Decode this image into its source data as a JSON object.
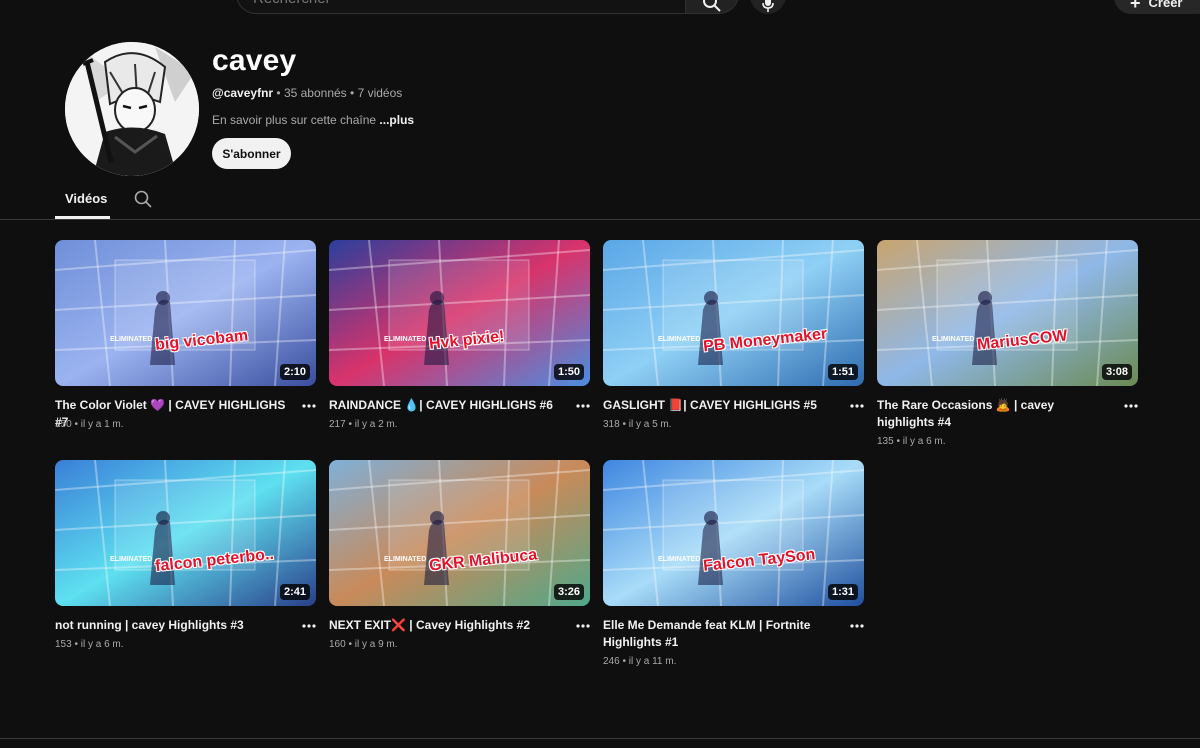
{
  "topbar": {
    "search_placeholder": "Rechercher",
    "create_label": "Créer"
  },
  "channel": {
    "name": "cavey",
    "handle": "@caveyfnr",
    "subscribers": "35 abonnés",
    "video_count": "7 vidéos",
    "separator": " • ",
    "about_text": "En savoir plus sur cette chaîne ",
    "about_more": "...plus",
    "subscribe_label": "S'abonner"
  },
  "tabs": {
    "videos_label": "Vidéos"
  },
  "videos": [
    {
      "title": "The Color Violet 💜 | CAVEY HIGHLIGHS #7",
      "views": "150",
      "age": "il y a 1 m.",
      "duration": "2:10",
      "overlay": "big vicobam",
      "palette": [
        "#6f8fd8",
        "#9bb3f0",
        "#3a4e9e"
      ]
    },
    {
      "title": "RAINDANCE 💧| CAVEY HIGHLIGHS #6",
      "views": "217",
      "age": "il y a 2 m.",
      "duration": "1:50",
      "overlay": "Hvk pixie!",
      "palette": [
        "#2b3f9c",
        "#d8336b",
        "#4a8ee0"
      ]
    },
    {
      "title": "GASLIGHT 📕| CAVEY HIGHLIGHS #5",
      "views": "318",
      "age": "il y a 5 m.",
      "duration": "1:51",
      "overlay": "PB Moneymaker",
      "palette": [
        "#5aa6e6",
        "#8fd0f5",
        "#2e6bb0"
      ]
    },
    {
      "title": "The Rare Occasions 🙇 | cavey highlights #4",
      "views": "135",
      "age": "il y a 6 m.",
      "duration": "3:08",
      "overlay": "MariusCOW",
      "palette": [
        "#c9a46f",
        "#8fb8e8",
        "#6b8a52"
      ]
    },
    {
      "title": "not running | cavey Highlights #3",
      "views": "153",
      "age": "il y a 6 m.",
      "duration": "2:41",
      "overlay": "falcon peterbo..",
      "palette": [
        "#3a7fd8",
        "#5ee0f0",
        "#2a3f8a"
      ]
    },
    {
      "title": "NEXT EXIT❌ | Cavey Highlights #2",
      "views": "160",
      "age": "il y a 9 m.",
      "duration": "3:26",
      "overlay": "GKR Malibuca",
      "palette": [
        "#7fb0d8",
        "#c98a5a",
        "#4fa88a"
      ]
    },
    {
      "title": "Elle Me Demande feat KLM | Fortnite Highlights #1",
      "views": "246",
      "age": "il y a 11 m.",
      "duration": "1:31",
      "overlay": "Falcon TaySon",
      "palette": [
        "#3f86e0",
        "#a8dcf8",
        "#1f4f9e"
      ]
    }
  ],
  "colors": {
    "background": "#0f0f0f",
    "text_primary": "#f1f1f1",
    "text_secondary": "#aaaaaa",
    "overlay_red": "#e3122b"
  },
  "icons": [
    "search-icon",
    "mic-icon",
    "plus-icon",
    "more-vert-icon"
  ]
}
